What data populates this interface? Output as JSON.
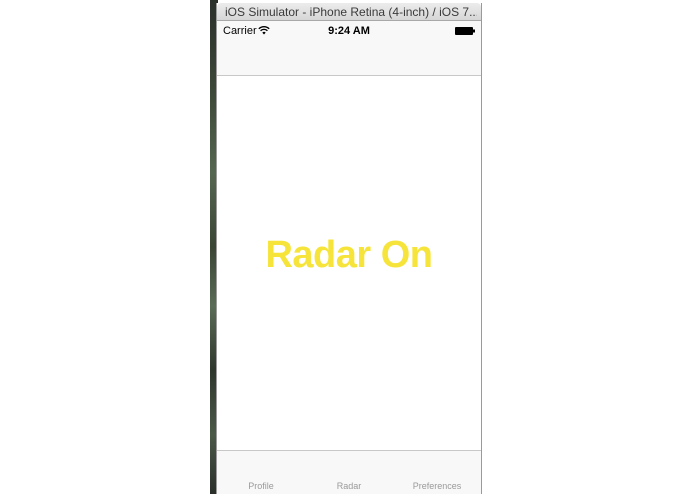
{
  "window": {
    "title": "iOS Simulator - iPhone Retina (4-inch) / iOS 7..."
  },
  "status_bar": {
    "carrier": "Carrier",
    "time": "9:24 AM",
    "wifi_icon": "wifi-icon",
    "battery_icon": "battery-icon"
  },
  "content": {
    "label": "Radar On",
    "label_color": "#f6e43a"
  },
  "tab_bar": {
    "tabs": [
      {
        "label": "Profile"
      },
      {
        "label": "Radar"
      },
      {
        "label": "Preferences"
      }
    ]
  }
}
